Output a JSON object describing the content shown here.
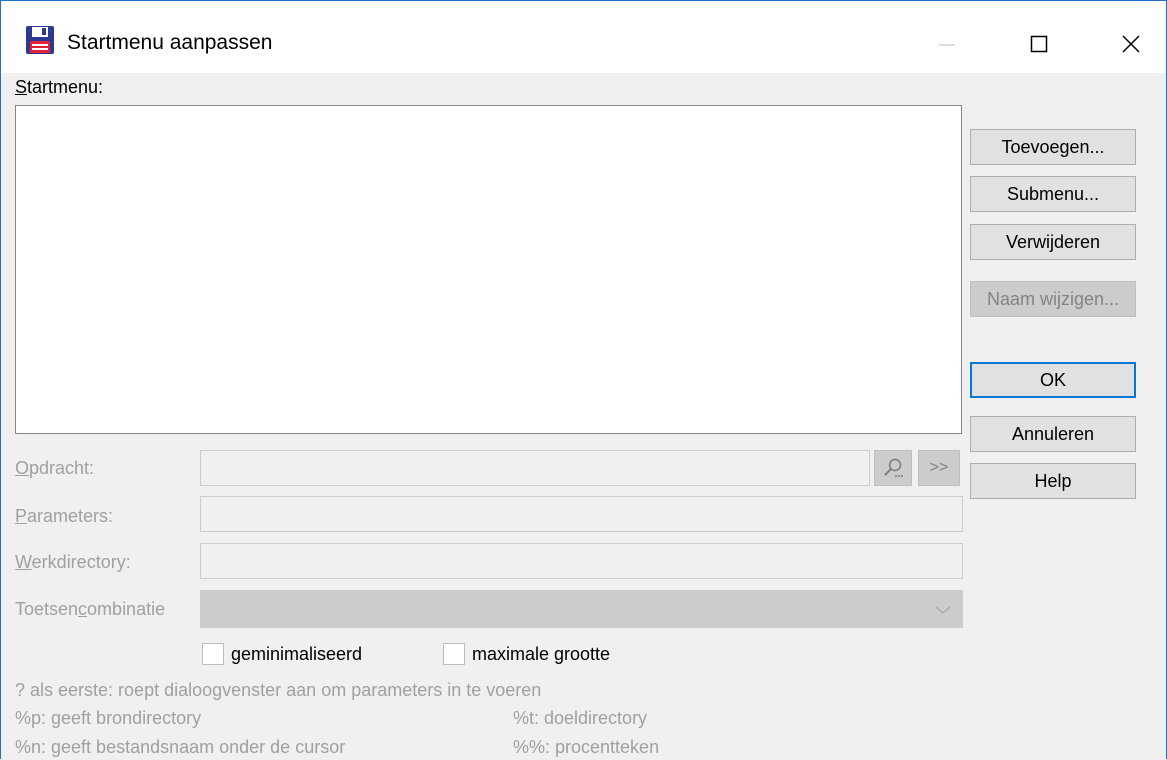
{
  "window": {
    "title": "Startmenu aanpassen",
    "icon": "floppy-disk-icon"
  },
  "titlebar_buttons": [
    {
      "name": "minimize",
      "icon": "minimize-icon"
    },
    {
      "name": "maximize",
      "icon": "maximize-icon"
    },
    {
      "name": "close",
      "icon": "close-icon"
    }
  ],
  "startmenu": {
    "label_underlined": "S",
    "label_rest": "tartmenu:",
    "items": []
  },
  "buttons": {
    "add": "Toevoegen...",
    "submenu": "Submenu...",
    "remove": "Verwijderen",
    "rename": "Naam wijzigen...",
    "ok": "OK",
    "cancel": "Annuleren",
    "help": "Help"
  },
  "fields": {
    "command": {
      "label_underlined": "O",
      "label_rest": "pdracht:",
      "value": ""
    },
    "parameters": {
      "label_underlined": "P",
      "label_rest": "arameters:",
      "value": ""
    },
    "workdir": {
      "label_underlined": "W",
      "label_rest": "erkdirectory:",
      "value": ""
    },
    "hotkey": {
      "label_pre": "Toetsen",
      "label_underlined": "c",
      "label_rest": "ombinatie",
      "value": ""
    }
  },
  "command_buttons": {
    "browse_icon": "search-icon",
    "expand": ">>"
  },
  "checkboxes": {
    "minimized": {
      "label": "geminimaliseerd",
      "checked": false
    },
    "maximized": {
      "label": "maximale grootte",
      "checked": false
    }
  },
  "hints": {
    "line1": "? als eerste: roept dialoogvenster aan om parameters in te voeren",
    "p": "%p: geeft brondirectory",
    "t": "%t: doeldirectory",
    "n": "%n: geeft bestandsnaam onder de cursor",
    "pct": "%%: procentteken"
  },
  "colors": {
    "accent": "#0078d7",
    "disabled_text": "#a0a0a0",
    "window_bg": "#f0f0f0"
  }
}
